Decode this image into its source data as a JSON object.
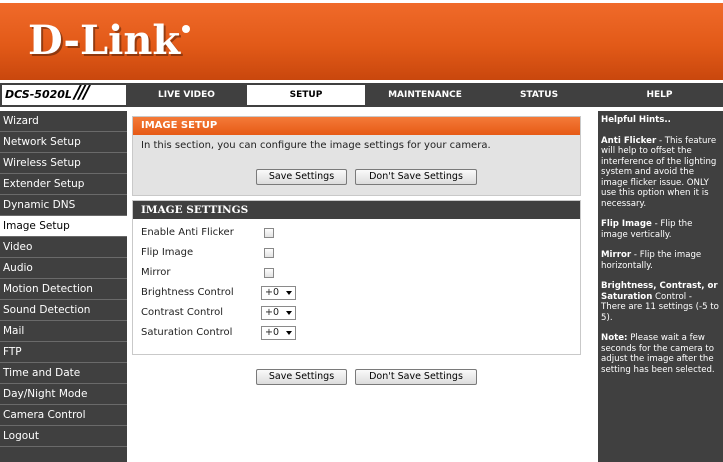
{
  "brand": {
    "logo_text": "D-Link",
    "model": "DCS-5020L",
    "slashes": "///"
  },
  "nav": {
    "tabs": [
      {
        "label": "LIVE VIDEO"
      },
      {
        "label": "SETUP"
      },
      {
        "label": "MAINTENANCE"
      },
      {
        "label": "STATUS"
      },
      {
        "label": "HELP"
      }
    ],
    "active_tab": "SETUP"
  },
  "sidebar": {
    "items": [
      {
        "label": "Wizard"
      },
      {
        "label": "Network Setup"
      },
      {
        "label": "Wireless Setup"
      },
      {
        "label": "Extender Setup"
      },
      {
        "label": "Dynamic DNS"
      },
      {
        "label": "Image Setup"
      },
      {
        "label": "Video"
      },
      {
        "label": "Audio"
      },
      {
        "label": "Motion Detection"
      },
      {
        "label": "Sound Detection"
      },
      {
        "label": "Mail"
      },
      {
        "label": "FTP"
      },
      {
        "label": "Time and Date"
      },
      {
        "label": "Day/Night Mode"
      },
      {
        "label": "Camera Control"
      },
      {
        "label": "Logout"
      }
    ],
    "active_item": "Image Setup"
  },
  "image_setup": {
    "title": "IMAGE SETUP",
    "description": "In this section, you can configure the image settings for your camera.",
    "save_label": "Save Settings",
    "dont_save_label": "Don't Save Settings"
  },
  "image_settings": {
    "title": "IMAGE SETTINGS",
    "anti_flicker_label": "Enable Anti Flicker",
    "flip_label": "Flip Image",
    "mirror_label": "Mirror",
    "brightness_label": "Brightness Control",
    "brightness_value": "+0",
    "contrast_label": "Contrast Control",
    "contrast_value": "+0",
    "saturation_label": "Saturation Control",
    "saturation_value": "+0"
  },
  "bottom_buttons": {
    "save_label": "Save Settings",
    "dont_save_label": "Don't Save Settings"
  },
  "help": {
    "title": "Helpful Hints..",
    "anti_flicker_term": "Anti Flicker",
    "anti_flicker_text": " - This feature will help to offset the interference of the lighting system and avoid the image flicker issue. ONLY use this option when it is necessary.",
    "flip_term": "Flip Image",
    "flip_text": " - Flip the image vertically.",
    "mirror_term": "Mirror",
    "mirror_text": " - Flip the image horizontally.",
    "bcs_term": "Brightness, Contrast, or Saturation",
    "bcs_text": " Control - There are 11 settings (-5 to 5).",
    "note_term": "Note:",
    "note_text": " Please wait a few seconds for the camera to adjust the image after the setting has been selected."
  },
  "colors": {
    "header_orange": "#e25a18",
    "dark_gray": "#404040",
    "panel_gray": "#e3e3e3"
  }
}
